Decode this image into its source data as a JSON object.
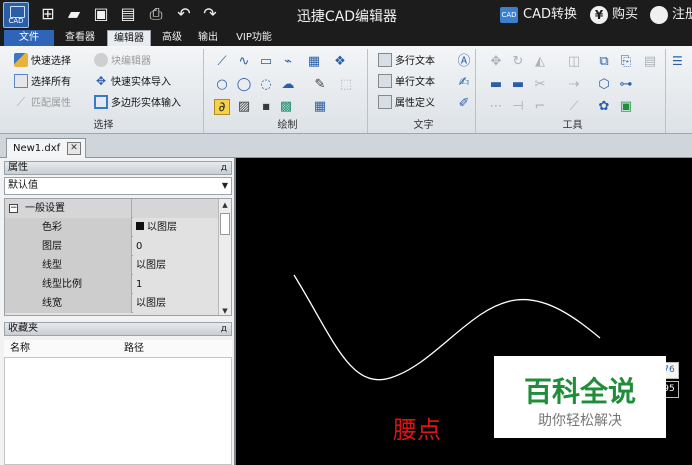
{
  "app": {
    "logo_text": "CAD",
    "title": "迅捷CAD编辑器",
    "cad_convert_badge": "CAD",
    "cad_convert": "CAD转换",
    "buy_symbol": "¥",
    "buy": "购买",
    "register_symbol": "",
    "register": "注册"
  },
  "menu": {
    "file": "文件",
    "items": [
      "查看器",
      "编辑器",
      "高级",
      "输出",
      "VIP功能"
    ],
    "active": "编辑器"
  },
  "ribbon": {
    "select": {
      "label": "选择",
      "quick_select": "快速选择",
      "block_editor": "块编辑器",
      "select_all": "选择所有",
      "quick_entity_import": "快速实体导入",
      "match_properties": "匹配属性",
      "polygon_entity_input": "多边形实体输入"
    },
    "draw": {
      "label": "绘制"
    },
    "text": {
      "label": "文字",
      "mtext": "多行文本",
      "stext": "单行文本",
      "attdef": "属性定义"
    },
    "tools": {
      "label": "工具"
    }
  },
  "document_tab": {
    "name": "New1.dxf",
    "close_symbol": "✕"
  },
  "properties_panel": {
    "title": "属性",
    "pin_symbol": "д",
    "dropdown_value": "默认值",
    "category": "一般设置",
    "rows": [
      {
        "name": "色彩",
        "value": "以图层"
      },
      {
        "name": "图层",
        "value": "0"
      },
      {
        "name": "线型",
        "value": "以图层"
      },
      {
        "name": "线型比例",
        "value": "1"
      },
      {
        "name": "线宽",
        "value": "以图层"
      }
    ]
  },
  "favorites_panel": {
    "title": "收藏夹",
    "pin_symbol": "д",
    "col_name": "名称",
    "col_path": "路径"
  },
  "canvas": {
    "coord_1": "76",
    "coord_2": "95",
    "annotation": "腰点"
  },
  "watermark": {
    "main": "百科全说",
    "sub": "助你轻松解决"
  }
}
